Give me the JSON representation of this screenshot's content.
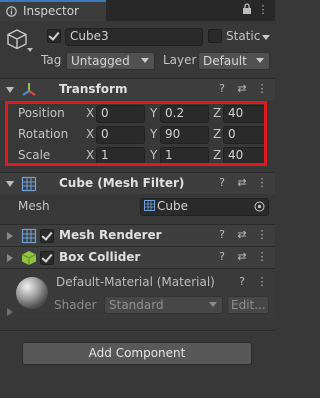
{
  "tab": {
    "title": "Inspector"
  },
  "object": {
    "name": "Cube3",
    "active": true,
    "static_label": "Static",
    "static_checked": false,
    "tag_label": "Tag",
    "tag_value": "Untagged",
    "layer_label": "Layer",
    "layer_value": "Default"
  },
  "transform": {
    "title": "Transform",
    "rows": [
      {
        "label": "Position",
        "x": "0",
        "y": "0.2",
        "z": "40"
      },
      {
        "label": "Rotation",
        "x": "0",
        "y": "90",
        "z": "0"
      },
      {
        "label": "Scale",
        "x": "1",
        "y": "1",
        "z": "40"
      }
    ],
    "axis": {
      "x": "X",
      "y": "Y",
      "z": "Z"
    },
    "highlight_color": "#e0181f"
  },
  "mesh_filter": {
    "title": "Cube (Mesh Filter)",
    "mesh_label": "Mesh",
    "mesh_value": "Cube"
  },
  "mesh_renderer": {
    "title": "Mesh Renderer",
    "enabled": true
  },
  "box_collider": {
    "title": "Box Collider",
    "enabled": true
  },
  "material": {
    "title": "Default-Material (Material)",
    "shader_label": "Shader",
    "shader_value": "Standard",
    "edit_label": "Edit..."
  },
  "add_component_label": "Add Component",
  "icons": {
    "help": "?",
    "settings": "⇄",
    "more": "⋮",
    "lock": "lock-icon",
    "menu": "⋮"
  }
}
